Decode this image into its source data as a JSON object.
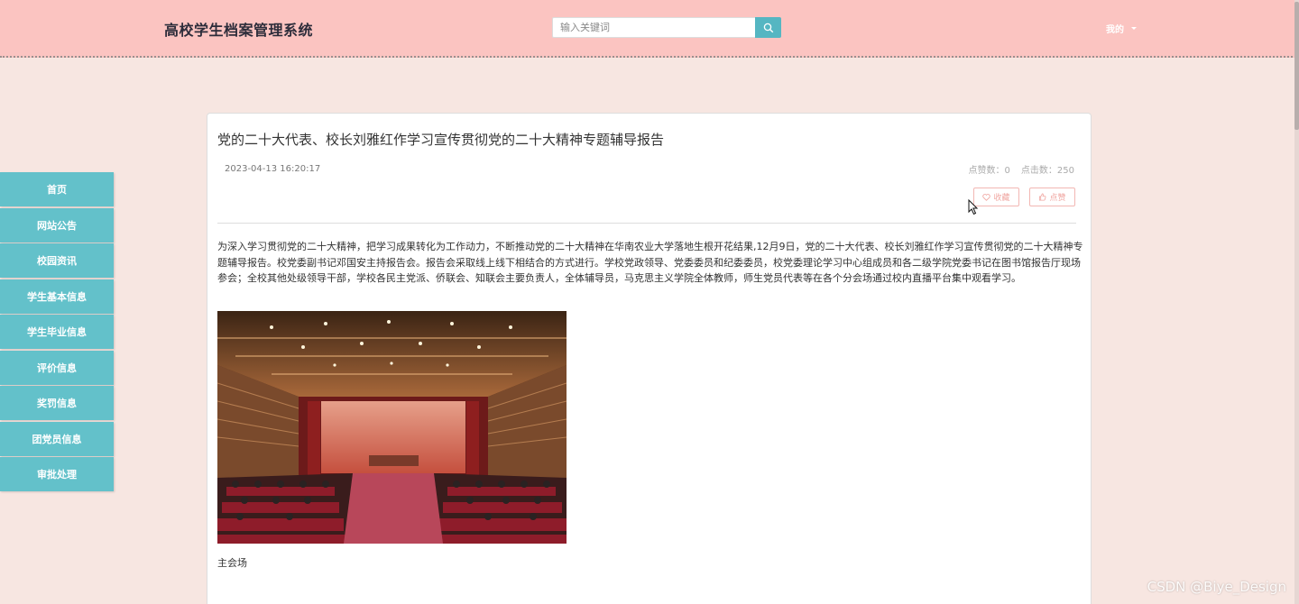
{
  "header": {
    "site_title": "高校学生档案管理系统",
    "search_placeholder": "输入关键词",
    "user_label": "我的"
  },
  "sidebar": {
    "items": [
      {
        "label": "首页"
      },
      {
        "label": "网站公告"
      },
      {
        "label": "校园资讯"
      },
      {
        "label": "学生基本信息"
      },
      {
        "label": "学生毕业信息"
      },
      {
        "label": "评价信息"
      },
      {
        "label": "奖罚信息"
      },
      {
        "label": "团党员信息"
      },
      {
        "label": "审批处理"
      }
    ]
  },
  "article": {
    "title": "党的二十大代表、校长刘雅红作学习宣传贯彻党的二十大精神专题辅导报告",
    "date": "2023-04-13 16:20:17",
    "likes_label": "点赞数：0",
    "clicks_label": "点击数：250",
    "favorite_label": "收藏",
    "like_label": "点赞",
    "body": "为深入学习贯彻党的二十大精神，把学习成果转化为工作动力，不断推动党的二十大精神在华南农业大学落地生根开花结果,12月9日，党的二十大代表、校长刘雅红作学习宣传贯彻党的二十大精神专题辅导报告。校党委副书记邓国安主持报告会。报告会采取线上线下相结合的方式进行。学校党政领导、党委委员和纪委委员，校党委理论学习中心组成员和各二级学院党委书记在图书馆报告厅现场参会；全校其他处级领导干部，学校各民主党派、侨联会、知联会主要负责人，全体辅导员，马克思主义学院全体教师，师生党员代表等在各个分会场通过校内直播平台集中观看学习。",
    "caption": "主会场"
  },
  "watermark": "CSDN @Biye_Design",
  "colors": {
    "header_bg": "#fbc4c1",
    "page_bg": "#f7e6e1",
    "sidebar_bg": "#63c1ca",
    "accent": "#55b6c2"
  }
}
